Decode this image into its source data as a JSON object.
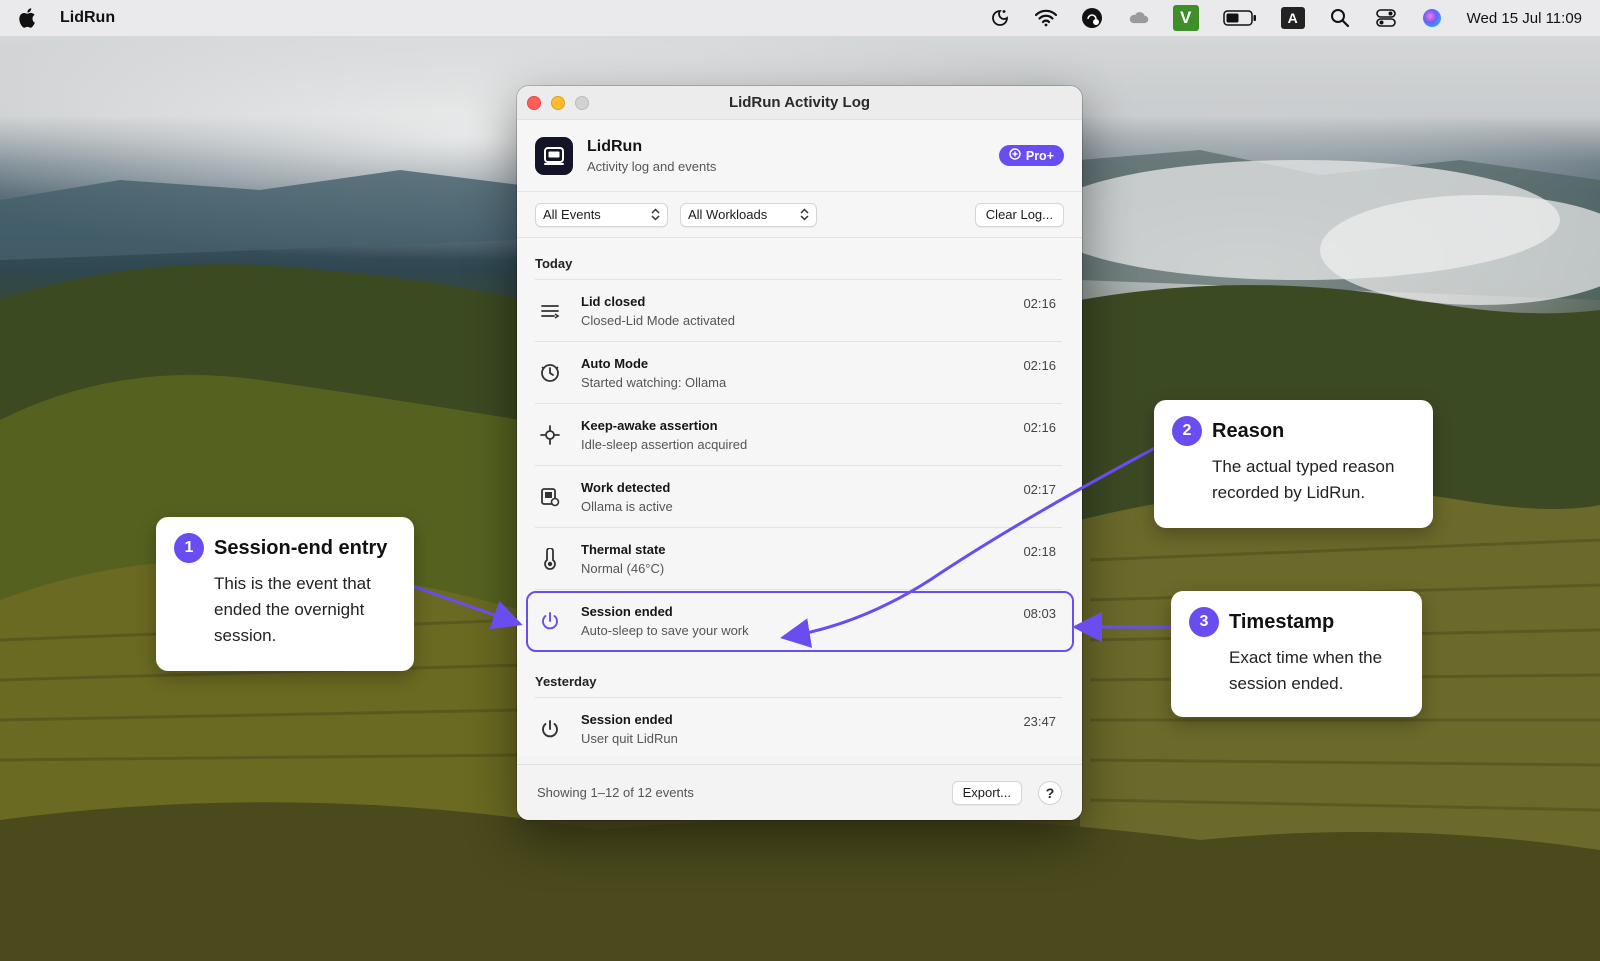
{
  "menubar": {
    "app_name": "LidRun",
    "clock": "Wed 15 Jul  11:09",
    "icons": [
      "apple-icon",
      "night-mode-icon",
      "wifi-icon",
      "status-app-icon",
      "cloud-icon",
      "v-app-icon",
      "battery-icon",
      "input-source-icon",
      "search-icon",
      "control-center-icon",
      "siri-icon"
    ],
    "input_source_label": "A",
    "v_label": "V"
  },
  "window": {
    "title": "LidRun Activity Log",
    "app_title": "LidRun",
    "app_subtitle": "Activity log and events",
    "badge": "Pro+",
    "filters": {
      "events": "All Events",
      "workloads": "All Workloads",
      "clear_label": "Clear Log..."
    },
    "sections": [
      {
        "label": "Today",
        "rows": [
          {
            "title": "Lid closed",
            "subtitle": "Closed-Lid Mode activated",
            "time": "02:16",
            "icon": "lid-icon"
          },
          {
            "title": "Auto Mode",
            "subtitle": "Started watching: Ollama",
            "time": "02:16",
            "icon": "auto-mode-icon"
          },
          {
            "title": "Keep-awake assertion",
            "subtitle": "Idle-sleep assertion acquired",
            "time": "02:16",
            "icon": "assertion-icon"
          },
          {
            "title": "Work detected",
            "subtitle": "Ollama is active",
            "time": "02:17",
            "icon": "work-icon"
          },
          {
            "title": "Thermal state",
            "subtitle": "Normal (46°C)",
            "time": "02:18",
            "icon": "thermal-icon"
          },
          {
            "title": "Session ended",
            "subtitle": "Auto-sleep to save your work",
            "time": "08:03",
            "icon": "power-icon"
          }
        ]
      },
      {
        "label": "Yesterday",
        "rows": [
          {
            "title": "Session ended",
            "subtitle": "User quit LidRun",
            "time": "23:47",
            "icon": "power-icon"
          }
        ]
      }
    ],
    "footer": {
      "count": "Showing 1–12 of 12 events",
      "export_label": "Export...",
      "help_label": "?"
    }
  },
  "callouts": [
    {
      "num": "1",
      "title": "Session-end entry",
      "body": "This is the event that ended the overnight session."
    },
    {
      "num": "2",
      "title": "Reason",
      "body": "The actual typed reason recorded by LidRun."
    },
    {
      "num": "3",
      "title": "Timestamp",
      "body": "Exact time when the session ended."
    }
  ],
  "colors": {
    "accent": "#6a4df0",
    "close": "#ff5f57",
    "minimize": "#febc2e",
    "app_icon_bg": "#141428"
  }
}
